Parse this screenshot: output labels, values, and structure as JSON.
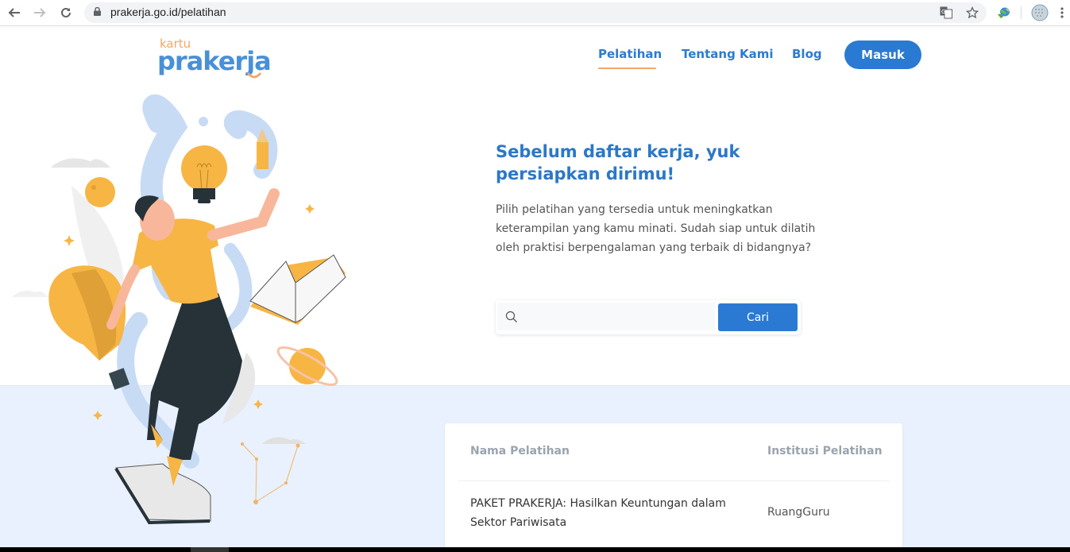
{
  "browser": {
    "url": "prakerja.go.id/pelatihan",
    "icons": [
      "back-icon",
      "forward-icon",
      "reload-icon",
      "lock-icon",
      "translate-icon",
      "star-icon",
      "extension-icon",
      "profile-avatar",
      "menu-icon"
    ]
  },
  "header": {
    "logo_small": "kartu",
    "logo_main": "prakerja",
    "nav": [
      {
        "label": "Pelatihan",
        "active": true
      },
      {
        "label": "Tentang Kami",
        "active": false
      },
      {
        "label": "Blog",
        "active": false
      }
    ],
    "login_label": "Masuk"
  },
  "hero": {
    "headline_line1": "Sebelum daftar kerja, yuk",
    "headline_line2": "persiapkan dirimu!",
    "description": "Pilih pelatihan yang tersedia untuk meningkatkan keterampilan yang kamu minati. Sudah siap untuk dilatih oleh praktisi berpengalaman yang terbaik di bidangnya?",
    "search": {
      "value": "",
      "placeholder": "",
      "button_label": "Cari"
    }
  },
  "table": {
    "columns": [
      "Nama Pelatihan",
      "Institusi Pelatihan"
    ],
    "rows": [
      {
        "name": "PAKET PRAKERJA: Hasilkan Keuntungan dalam Sektor Pariwisata",
        "institution": "RuangGuru"
      }
    ]
  },
  "colors": {
    "brand_blue": "#2a7ad3",
    "brand_orange": "#f3a86b",
    "illustration_yellow": "#f7b543",
    "lower_bg": "#e8f1fd"
  }
}
